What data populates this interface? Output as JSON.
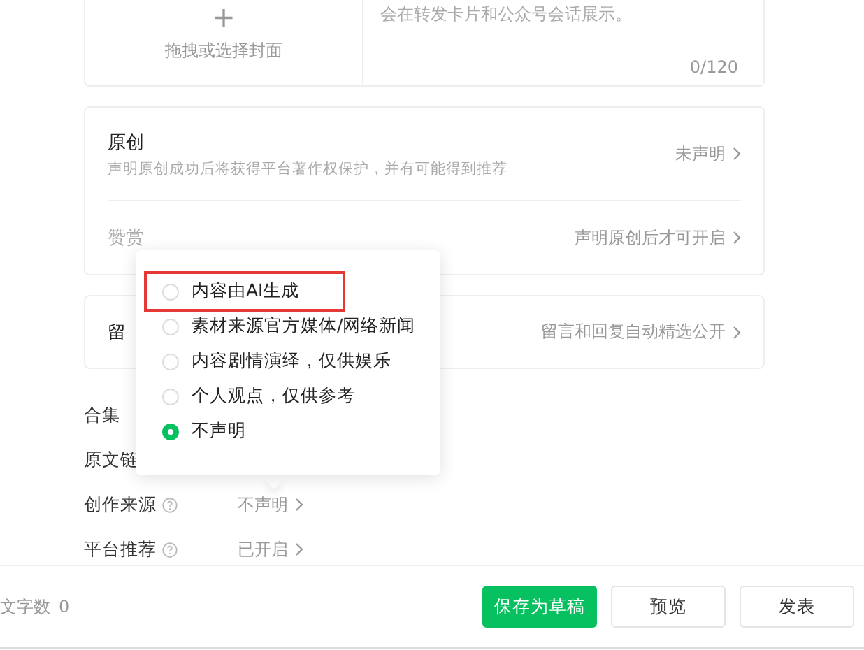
{
  "cover_upload": {
    "plus": "+",
    "label": "拖拽或选择封面"
  },
  "summary": {
    "placeholder": "会在转发卡片和公众号会话展示。",
    "counter": "0/120"
  },
  "settings_card": [
    {
      "title": "原创",
      "bold": true,
      "description": "声明原创成功后将获得平台著作权保护，并有可能得到推荐",
      "value": "未声明"
    },
    {
      "title": "赞赏",
      "bold": false,
      "value": "声明原创后才可开启"
    }
  ],
  "comment_card": {
    "title": "留",
    "value": "留言和回复自动精选公开"
  },
  "form_rows": [
    {
      "label": "合集"
    },
    {
      "label": "原文链"
    },
    {
      "label": "创作来源",
      "help": true,
      "value": "不声明"
    },
    {
      "label": "平台推荐",
      "help": true,
      "value": "已开启"
    }
  ],
  "source_popup": {
    "options": [
      {
        "label": "内容由AI生成",
        "selected": false,
        "highlighted": true
      },
      {
        "label": "素材来源官方媒体/网络新闻",
        "selected": false,
        "highlighted": false
      },
      {
        "label": "内容剧情演绎，仅供娱乐",
        "selected": false,
        "highlighted": false
      },
      {
        "label": "个人观点，仅供参考",
        "selected": false,
        "highlighted": false
      },
      {
        "label": "不声明",
        "selected": true,
        "highlighted": false
      }
    ]
  },
  "footer": {
    "word_count_label": "文字数",
    "word_count": "0",
    "buttons": [
      {
        "label": "保存为草稿",
        "kind": "primary"
      },
      {
        "label": "预览",
        "kind": "default"
      },
      {
        "label": "发表",
        "kind": "default"
      }
    ]
  }
}
